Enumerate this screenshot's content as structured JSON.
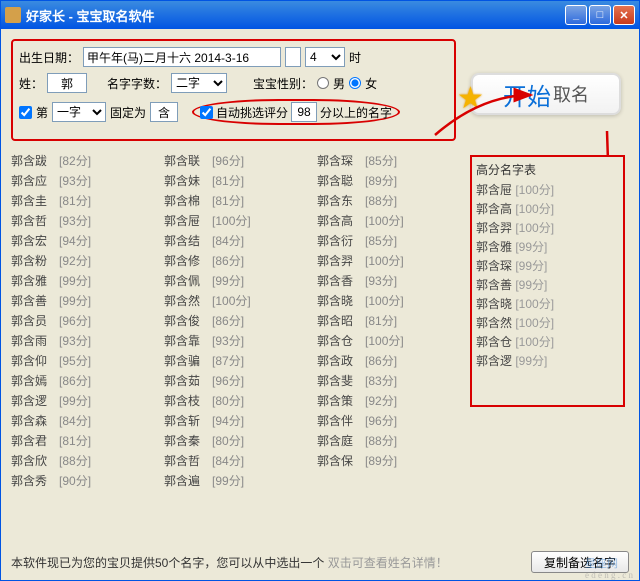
{
  "titlebar": {
    "title": "好家长 - 宝宝取名软件"
  },
  "form": {
    "birth_label": "出生日期：",
    "birth_value": "甲午年(马)二月十六 2014-3-16",
    "hour_value": "4",
    "hour_suffix": "时",
    "surname_label": "姓：",
    "surname_value": "郭",
    "char_count_label": "名字字数：",
    "char_count_value": "二字",
    "gender_label": "宝宝性别：",
    "gender_male": "男",
    "gender_female": "女",
    "pos_prefix": "第",
    "pos_value": "一字",
    "fix_label": "固定为",
    "fix_value": "含",
    "auto_filter_label": "自动挑选评分",
    "auto_filter_score": "98",
    "auto_filter_suffix": "分以上的名字"
  },
  "start": {
    "big": "开始",
    "small": "取名"
  },
  "names": [
    {
      "n": "郭含跋",
      "s": "[82分]"
    },
    {
      "n": "郭含应",
      "s": "[93分]"
    },
    {
      "n": "郭含圭",
      "s": "[81分]"
    },
    {
      "n": "郭含哲",
      "s": "[93分]"
    },
    {
      "n": "郭含宏",
      "s": "[94分]"
    },
    {
      "n": "郭含粉",
      "s": "[92分]"
    },
    {
      "n": "郭含雅",
      "s": "[99分]"
    },
    {
      "n": "郭含善",
      "s": "[99分]"
    },
    {
      "n": "郭含员",
      "s": "[96分]"
    },
    {
      "n": "郭含雨",
      "s": "[93分]"
    },
    {
      "n": "郭含仰",
      "s": "[95分]"
    },
    {
      "n": "郭含嫣",
      "s": "[86分]"
    },
    {
      "n": "郭含逻",
      "s": "[99分]"
    },
    {
      "n": "郭含森",
      "s": "[84分]"
    },
    {
      "n": "郭含君",
      "s": "[81分]"
    },
    {
      "n": "郭含欣",
      "s": "[88分]"
    },
    {
      "n": "郭含秀",
      "s": "[90分]"
    },
    {
      "n": "郭含联",
      "s": "[96分]"
    },
    {
      "n": "郭含妹",
      "s": "[81分]"
    },
    {
      "n": "郭含棉",
      "s": "[81分]"
    },
    {
      "n": "郭含屉",
      "s": "[100分]"
    },
    {
      "n": "郭含结",
      "s": "[84分]"
    },
    {
      "n": "郭含修",
      "s": "[86分]"
    },
    {
      "n": "郭含佩",
      "s": "[99分]"
    },
    {
      "n": "郭含然",
      "s": "[100分]"
    },
    {
      "n": "郭含俊",
      "s": "[86分]"
    },
    {
      "n": "郭含靠",
      "s": "[93分]"
    },
    {
      "n": "郭含骗",
      "s": "[87分]"
    },
    {
      "n": "郭含茹",
      "s": "[96分]"
    },
    {
      "n": "郭含枝",
      "s": "[80分]"
    },
    {
      "n": "郭含斩",
      "s": "[94分]"
    },
    {
      "n": "郭含秦",
      "s": "[80分]"
    },
    {
      "n": "郭含哲",
      "s": "[84分]"
    },
    {
      "n": "郭含遍",
      "s": "[99分]"
    },
    {
      "n": "郭含琛",
      "s": "[85分]"
    },
    {
      "n": "郭含聪",
      "s": "[89分]"
    },
    {
      "n": "郭含东",
      "s": "[88分]"
    },
    {
      "n": "郭含高",
      "s": "[100分]"
    },
    {
      "n": "郭含衍",
      "s": "[85分]"
    },
    {
      "n": "郭含羿",
      "s": "[100分]"
    },
    {
      "n": "郭含香",
      "s": "[93分]"
    },
    {
      "n": "郭含晓",
      "s": "[100分]"
    },
    {
      "n": "郭含昭",
      "s": "[81分]"
    },
    {
      "n": "郭含仓",
      "s": "[100分]"
    },
    {
      "n": "郭含政",
      "s": "[86分]"
    },
    {
      "n": "郭含斐",
      "s": "[83分]"
    },
    {
      "n": "郭含策",
      "s": "[92分]"
    },
    {
      "n": "郭含伴",
      "s": "[96分]"
    },
    {
      "n": "郭含庭",
      "s": "[88分]"
    },
    {
      "n": "郭含保",
      "s": "[89分]"
    }
  ],
  "highscore": {
    "title": "高分名字表",
    "items": [
      {
        "n": "郭含屉",
        "s": "[100分]"
      },
      {
        "n": "郭含高",
        "s": "[100分]"
      },
      {
        "n": "郭含羿",
        "s": "[100分]"
      },
      {
        "n": "郭含雅",
        "s": "[99分]"
      },
      {
        "n": "郭含琛",
        "s": "[99分]"
      },
      {
        "n": "郭含善",
        "s": "[99分]"
      },
      {
        "n": "郭含晓",
        "s": "[100分]"
      },
      {
        "n": "郭含然",
        "s": "[100分]"
      },
      {
        "n": "郭含仓",
        "s": "[100分]"
      },
      {
        "n": "郭含逻",
        "s": "[99分]"
      }
    ]
  },
  "footer": {
    "msg": "本软件现已为您的宝贝提供50个名字，您可以从中选出一个",
    "hint": "双击可查看姓名详情！",
    "copy": "复制备选名字"
  },
  "watermark": {
    "a": "星座网",
    "b": "e d e n g . c n"
  }
}
